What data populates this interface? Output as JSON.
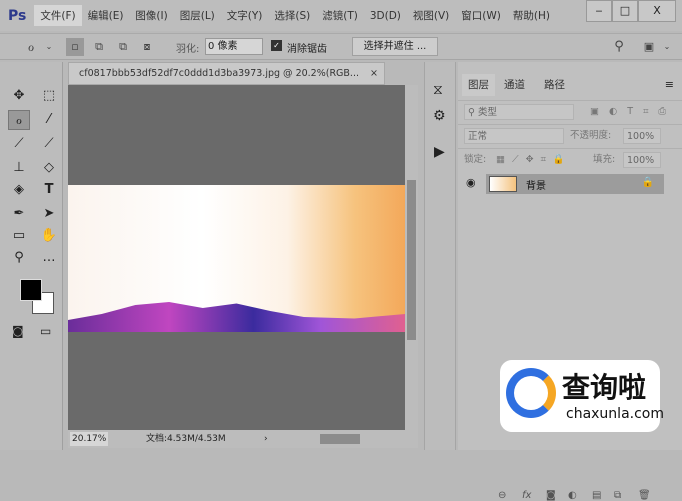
{
  "app": {
    "logo": "Ps"
  },
  "menu": [
    "文件(F)",
    "编辑(E)",
    "图像(I)",
    "图层(L)",
    "文字(Y)",
    "选择(S)",
    "滤镜(T)",
    "3D(D)",
    "视图(V)",
    "窗口(W)",
    "帮助(H)"
  ],
  "window": {
    "minimize": "‒",
    "maximize": "□",
    "close": "X"
  },
  "options": {
    "feather_label": "羽化:",
    "feather_value": "0 像素",
    "antialias_label": "消除锯齿",
    "antialias_checked": true,
    "select_mask_button": "选择并遮住 ..."
  },
  "document": {
    "tab_title": "cf0817bbb53df52df7c0ddd1d3ba3973.jpg @ 20.2%(RGB...",
    "close": "×",
    "zoom": "20.17%",
    "doc_info": "文档:4.53M/4.53M"
  },
  "layers_panel": {
    "tabs": [
      "图层",
      "通道",
      "路径"
    ],
    "filter_placeholder": "类型",
    "blend_mode": "正常",
    "opacity_label": "不透明度:",
    "opacity": "100%",
    "lock_label": "锁定:",
    "fill_label": "填充:",
    "fill": "100%",
    "layers": [
      {
        "name": "背景",
        "visible": true,
        "locked": true
      }
    ]
  },
  "watermark": {
    "brand": "查询啦",
    "url": "chaxunla.com"
  }
}
